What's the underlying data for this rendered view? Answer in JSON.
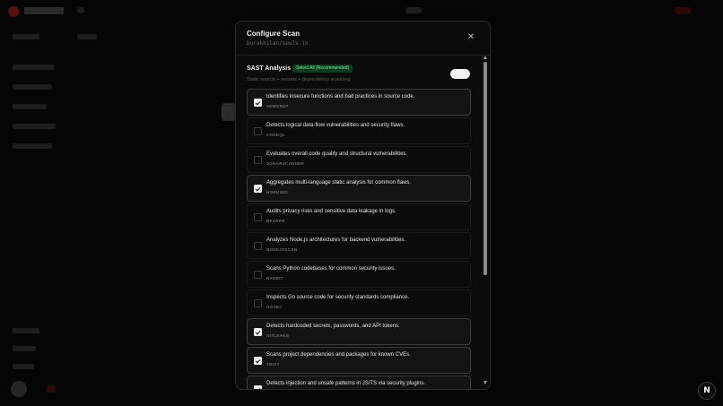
{
  "modal": {
    "title": "Configure Scan",
    "subtitle": "burakkilan/souls-in",
    "close_icon": "close-icon"
  },
  "section": {
    "title": "SAST Analysis",
    "select_all_label": "Select All (Recommended)",
    "description": "Static source + secrets + dependency scanning",
    "toggle_on": true
  },
  "tools": [
    {
      "description": "Identifies insecure functions and bad practices in source code.",
      "name": "SEMGREP",
      "selected": true
    },
    {
      "description": "Detects logical data-flow vulnerabilities and security flaws.",
      "name": "CODEQL",
      "selected": false
    },
    {
      "description": "Evaluates overall code quality and structural vulnerabilities.",
      "name": "SONARSCANNER",
      "selected": false
    },
    {
      "description": "Aggregates multi-language static analysis for common flaws.",
      "name": "HORUSEC",
      "selected": true
    },
    {
      "description": "Audits privacy risks and sensitive data leakage in logs.",
      "name": "BEARER",
      "selected": false
    },
    {
      "description": "Analyzes Node.js architectures for backend vulnerabilities.",
      "name": "NODEJSSCAN",
      "selected": false
    },
    {
      "description": "Scans Python codebases for common security issues.",
      "name": "BANDIT",
      "selected": false
    },
    {
      "description": "Inspects Go source code for security standards compliance.",
      "name": "GOSEC",
      "selected": false
    },
    {
      "description": "Detects hardcoded secrets, passwords, and API tokens.",
      "name": "GITLEAKS",
      "selected": true
    },
    {
      "description": "Scans project dependencies and packages for known CVEs.",
      "name": "TRIVY",
      "selected": true
    },
    {
      "description": "Detects injection and unsafe patterns in JS/TS via security plugins.",
      "name": "",
      "selected": true
    }
  ],
  "corner_button": "N",
  "colors": {
    "accent_green_bg": "#0f3a1d",
    "accent_green_text": "#7ff0a6",
    "modal_bg": "#0b0b0b"
  }
}
